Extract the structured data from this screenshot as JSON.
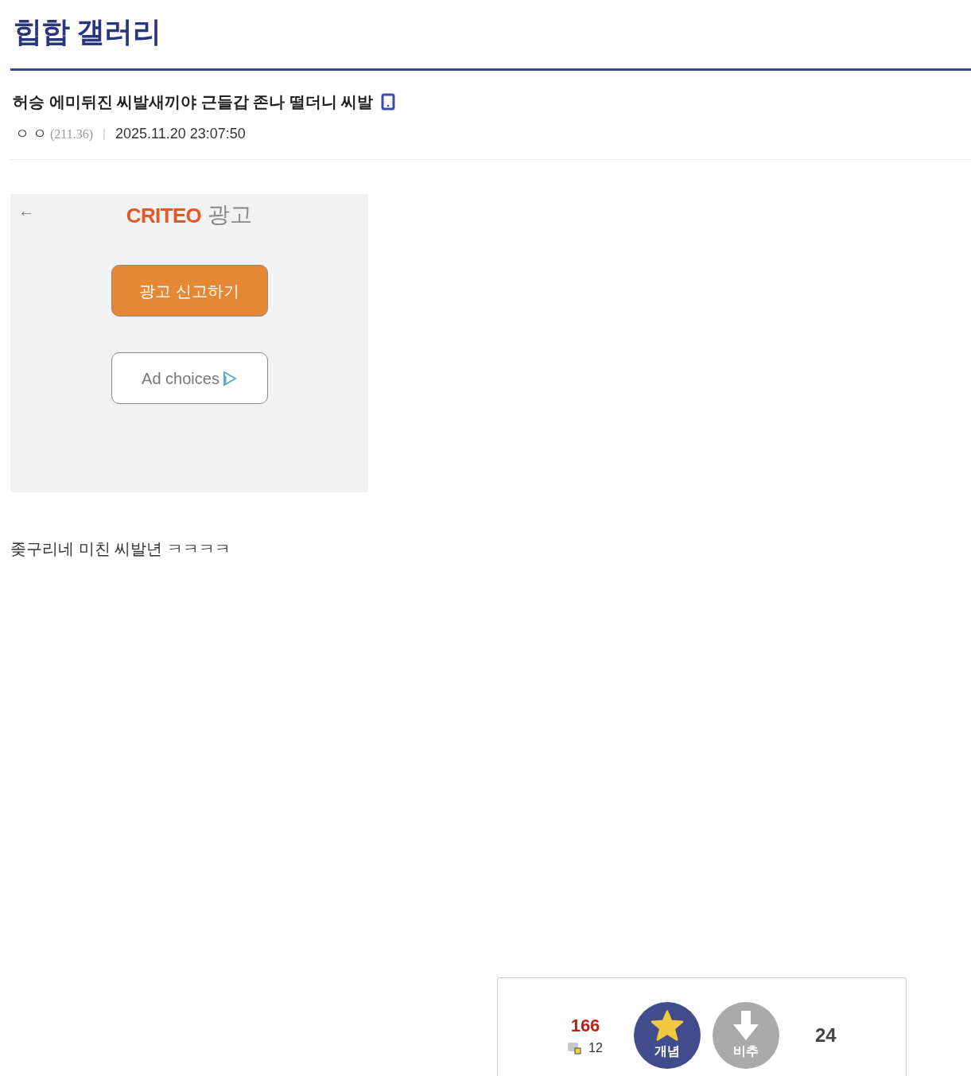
{
  "gallery": {
    "title": "힙합 갤러리"
  },
  "post": {
    "title": "허승 에미뒤진 씨발새끼야 근들갑 존나 떨더니 씨발",
    "mobile": true,
    "author": "ㅇㅇ",
    "ip": "(211.36)",
    "separator": "|",
    "date": "2025.11.20 23:07:50"
  },
  "ad": {
    "back": "←",
    "brand": "CRITEO",
    "label": "광고",
    "report_button": "광고 신고하기",
    "choices_button": "Ad choices"
  },
  "body": "좆구리네 미친 씨발년 ㅋㅋㅋㅋ",
  "votes": {
    "up_count": "166",
    "fixed_count": "12",
    "up_label": "개념",
    "down_label": "비추",
    "down_count": "24"
  }
}
